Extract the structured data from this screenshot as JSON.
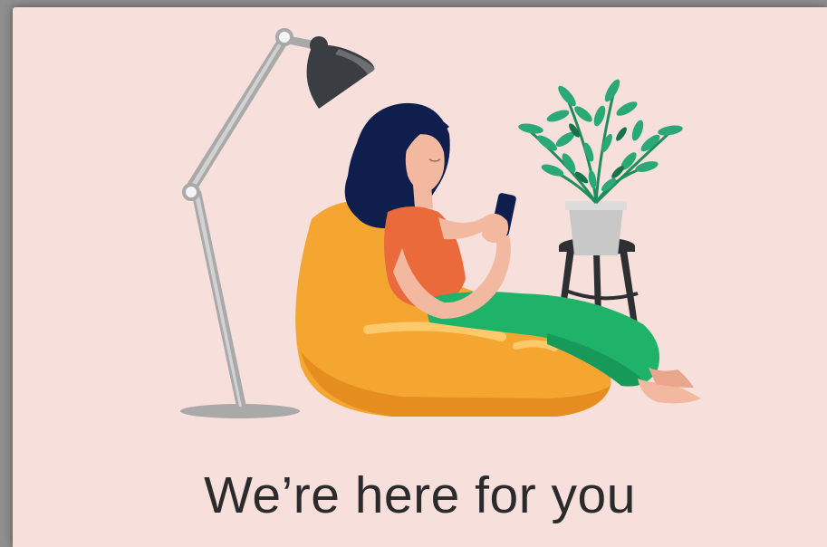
{
  "card": {
    "tagline": "We’re here for you"
  },
  "illustration": {
    "elements": [
      "floor-lamp",
      "woman-reading-phone",
      "bean-bag-chair",
      "potted-plant",
      "stool"
    ]
  },
  "colors": {
    "background": "#f7dfdb",
    "beanbag": "#f5a631",
    "shirt": "#ea6a3b",
    "pants": "#1fb36a",
    "hair": "#0f1e4d",
    "lamp": "#a9a9a9",
    "lamp_shade": "#3a3d42",
    "plant": "#2aa876",
    "pot": "#c8c8c8",
    "stool": "#2d2f33",
    "text": "#2b2b2b"
  }
}
